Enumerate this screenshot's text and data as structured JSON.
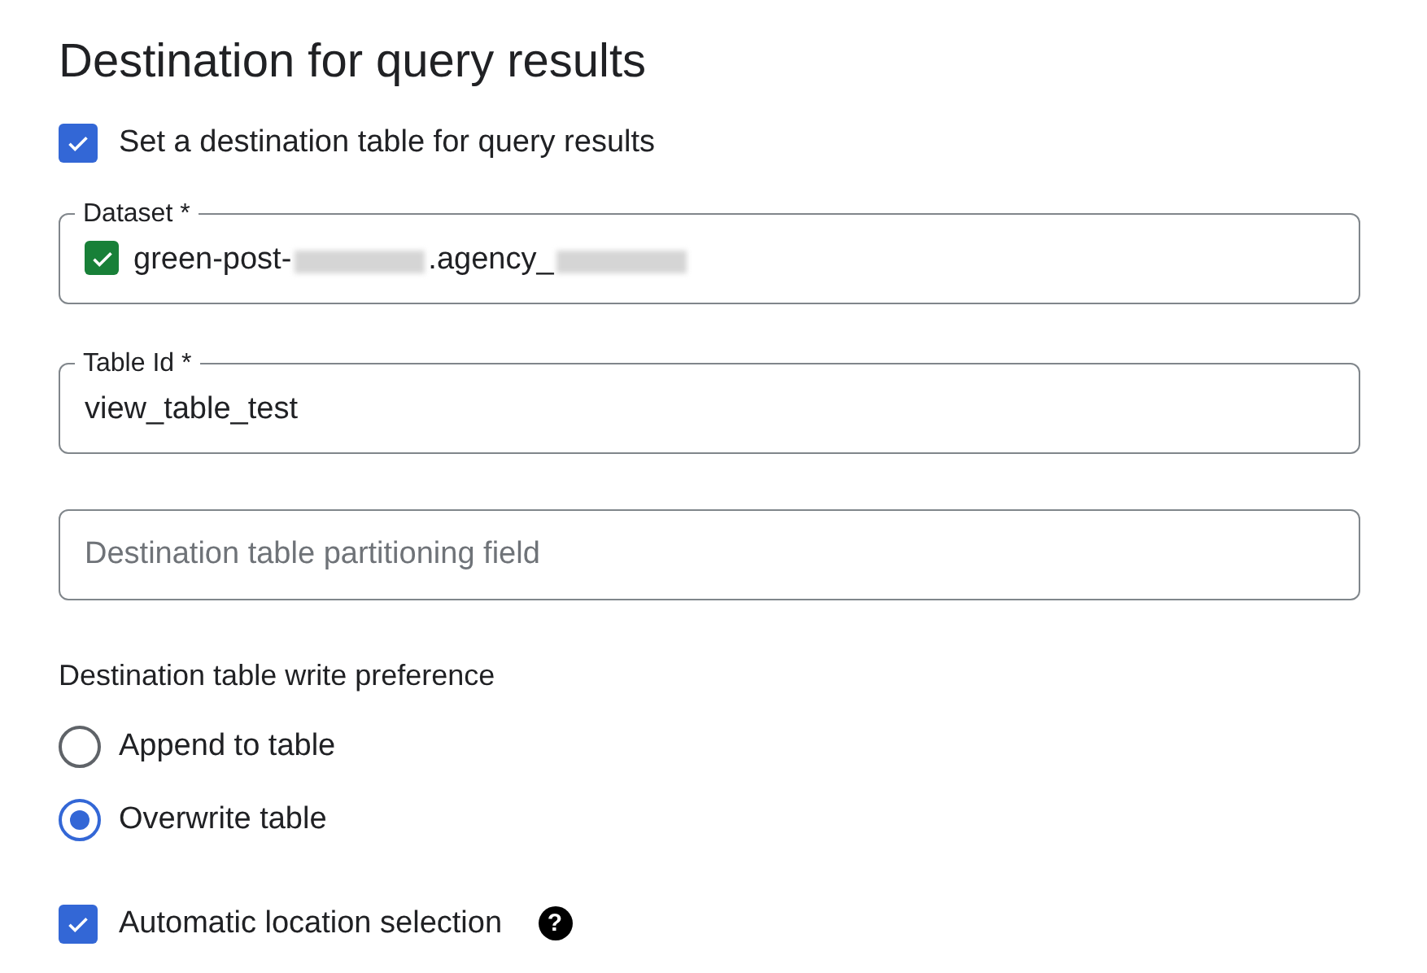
{
  "title": "Destination for query results",
  "set_destination": {
    "label": "Set a destination table for query results",
    "checked": true
  },
  "fields": [
    {
      "label": "Dataset *",
      "value_parts": [
        {
          "kind": "text",
          "text": "green-post-"
        },
        {
          "kind": "redacted"
        },
        {
          "kind": "text",
          "text": ".agency_"
        },
        {
          "kind": "redacted"
        }
      ],
      "valid": true
    },
    {
      "label": "Table Id *",
      "value_parts": [
        {
          "kind": "text",
          "text": "view_table_test"
        }
      ]
    },
    {
      "placeholder": "Destination table partitioning field"
    }
  ],
  "write_preference": {
    "label": "Destination table write preference",
    "options": [
      {
        "label": "Append to table",
        "selected": false
      },
      {
        "label": "Overwrite table",
        "selected": true
      }
    ]
  },
  "auto_location": {
    "label": "Automatic location selection",
    "checked": true,
    "help": "?"
  }
}
